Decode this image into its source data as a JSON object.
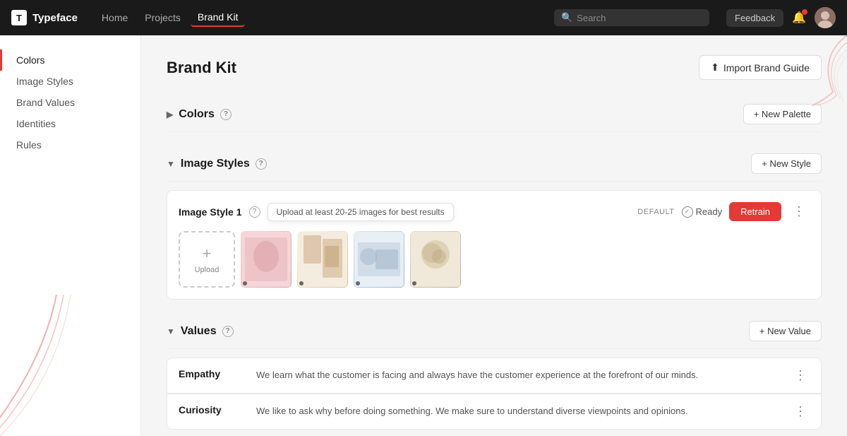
{
  "app": {
    "name": "Typeface",
    "logo_letter": "T"
  },
  "topnav": {
    "links": [
      {
        "label": "Home",
        "active": false
      },
      {
        "label": "Projects",
        "active": false
      },
      {
        "label": "Brand Kit",
        "active": true
      }
    ],
    "search_placeholder": "Search",
    "feedback_label": "Feedback"
  },
  "sidebar": {
    "items": [
      {
        "label": "Colors",
        "active": true
      },
      {
        "label": "Image Styles",
        "active": false
      },
      {
        "label": "Brand Values",
        "active": false
      },
      {
        "label": "Identities",
        "active": false
      },
      {
        "label": "Rules",
        "active": false
      }
    ]
  },
  "main": {
    "title": "Brand Kit",
    "import_btn": "Import Brand Guide",
    "sections": {
      "colors": {
        "title": "Colors",
        "new_btn": "+ New Palette"
      },
      "image_styles": {
        "title": "Image Styles",
        "new_btn": "+ New Style",
        "card": {
          "name": "Image Style 1",
          "tooltip": "Upload at least 20-25 images for best results",
          "default_label": "DEFAULT",
          "ready_label": "Ready",
          "retrain_btn": "Retrain"
        }
      },
      "values": {
        "title": "Values",
        "new_btn": "+ New Value",
        "items": [
          {
            "name": "Empathy",
            "description": "We learn what the customer is facing and always have the customer experience at the forefront of our minds."
          },
          {
            "name": "Curiosity",
            "description": "We like to ask why before doing something. We make sure to understand diverse viewpoints and opinions."
          }
        ]
      }
    }
  }
}
